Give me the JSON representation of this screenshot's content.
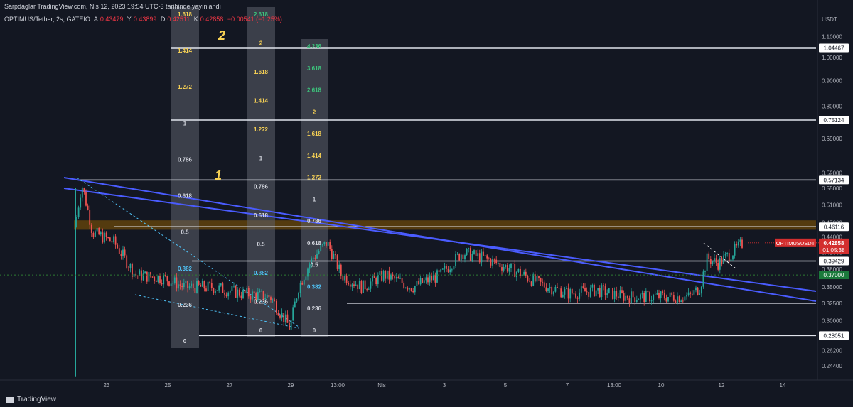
{
  "header": {
    "publish_line": "Sarpdaglar TradingView.com, Nis 12, 2023 19:54 UTC-3 tarihinde yayınlandı",
    "symbol": "OPTIMUS/Tether, 2s, GATEIO",
    "o_label": "A",
    "o": "0.43479",
    "h_label": "Y",
    "h": "0.43899",
    "l_label": "D",
    "l": "0.42511",
    "c_label": "K",
    "c": "0.42858",
    "change": "−0.00541 (−1.25%)"
  },
  "brand": "TradingView",
  "colors": {
    "background": "#131722",
    "up": "#26a69a",
    "down": "#ef5350",
    "channel": "#4a5cff",
    "resistance_zone": "#8a5a00",
    "price_tag": "#d32f2f",
    "green_tag": "#1b7a3c",
    "fib_gold": "#f7d154",
    "fib_green": "#3cc47c"
  },
  "chart_data": {
    "type": "candlestick",
    "y_unit": "USDT",
    "y_scale": "log",
    "ylim": [
      0.23,
      1.15
    ],
    "y_ticks": [
      "1.10000",
      "1.00000",
      "0.90000",
      "0.80000",
      "0.69000",
      "0.59000",
      "0.55000",
      "0.51000",
      "0.47000",
      "0.44000",
      "0.41000",
      "0.38000",
      "0.35000",
      "0.32500",
      "0.30000",
      "0.28000",
      "0.26200",
      "0.24400"
    ],
    "x_ticks": [
      "23",
      "25",
      "27",
      "29",
      "13:00",
      "Nis",
      "3",
      "5",
      "7",
      "13:00",
      "10",
      "12",
      "14"
    ],
    "horizontal_levels": [
      {
        "value": 1.04467,
        "label": "1.04467"
      },
      {
        "value": 0.75124,
        "label": "0.75124"
      },
      {
        "value": 0.57134,
        "label": "0.57134"
      },
      {
        "value": 0.46116,
        "label": "0.46116"
      },
      {
        "value": 0.39429,
        "label": "0.39429"
      },
      {
        "value": 0.28051,
        "label": "0.28051"
      }
    ],
    "support_line": 0.325,
    "last_price": {
      "value": 0.42858,
      "symbol": "OPTIMUSUSDT",
      "countdown": "01:05:38"
    },
    "green_level": {
      "value": 0.37,
      "label": "0.37000"
    },
    "annotations": [
      "1",
      "2"
    ],
    "fib_levels": {
      "fib_a": [
        "1.618",
        "1.414",
        "1.272",
        "1",
        "0.786",
        "0.618",
        "0.5",
        "0.382",
        "0.236",
        "0"
      ],
      "fib_b": [
        "2.618",
        "2",
        "1.618",
        "1.414",
        "1.272",
        "1",
        "0.786",
        "0.618",
        "0.5",
        "0.382",
        "0.236",
        "0"
      ],
      "fib_c": [
        "4.236",
        "3.618",
        "2.618",
        "2",
        "1.618",
        "1.414",
        "1.272",
        "1",
        "0.786",
        "0.618",
        "0.5",
        "0.382",
        "0.236",
        "0"
      ]
    }
  }
}
